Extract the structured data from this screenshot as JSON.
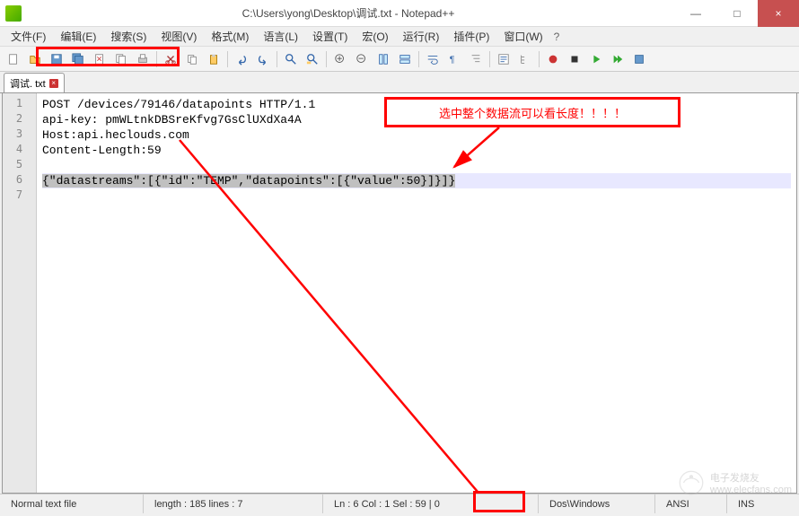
{
  "title": "C:\\Users\\yong\\Desktop\\调试.txt - Notepad++",
  "window": {
    "minimize": "—",
    "maximize": "□",
    "close": "×"
  },
  "menus": [
    "文件(F)",
    "编辑(E)",
    "搜索(S)",
    "视图(V)",
    "格式(M)",
    "语言(L)",
    "设置(T)",
    "宏(O)",
    "运行(R)",
    "插件(P)",
    "窗口(W)"
  ],
  "menu_help": "?",
  "tab": {
    "label": "调试. txt",
    "close": "×"
  },
  "gutter": [
    "1",
    "2",
    "3",
    "4",
    "5",
    "6",
    "7"
  ],
  "lines": {
    "l1": "POST /devices/79146/datapoints HTTP/1.1",
    "l2": "api-key: pmWLtnkDBSreKfvg7GsClUXdXa4A",
    "l3": "Host:api.heclouds.com",
    "l4": "Content-Length:59",
    "l5": "",
    "l6": "{\"datastreams\":[{\"id\":\"TEMP\",\"datapoints\":[{\"value\":50}]}]}",
    "l7": ""
  },
  "annotation": "选中整个数据流可以看长度！！！！",
  "status": {
    "type": "Normal text file",
    "length": "length : 185    lines : 7",
    "pos": "Ln : 6    Col : 1    Sel : 59 | 0",
    "eol": "Dos\\Windows",
    "enc": "ANSI",
    "ins": "INS"
  },
  "watermark": "电子发烧友\nwww.elecfans.com"
}
